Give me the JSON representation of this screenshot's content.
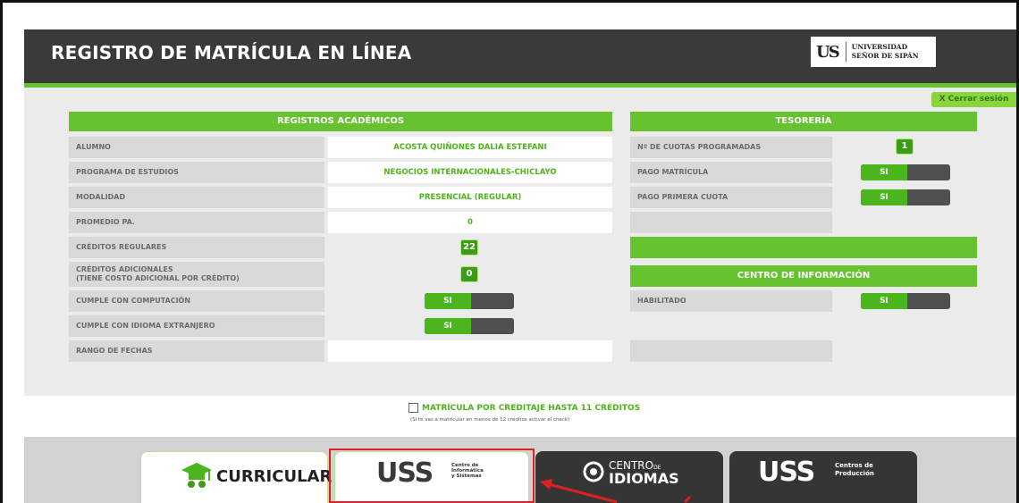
{
  "header": {
    "title": "REGISTRO DE MATRÍCULA EN LÍNEA",
    "logo_mark": "US",
    "logo_line1": "UNIVERSIDAD",
    "logo_line2": "SEÑOR DE SIPÁN",
    "logout": "X Cerrar sesión"
  },
  "academic": {
    "heading": "REGISTROS ACADÉMICOS",
    "rows": [
      {
        "label": "ALUMNO",
        "value": "ACOSTA QUIÑONES DALIA ESTEFANI"
      },
      {
        "label": "PROGRAMA DE ESTUDIOS",
        "value": "NEGOCIOS INTERNACIONALES-CHICLAYO"
      },
      {
        "label": "MODALIDAD",
        "value": "PRESENCIAL (REGULAR)"
      },
      {
        "label": "PROMEDIO PA.",
        "value": "0"
      },
      {
        "label": "CRÉDITOS REGULARES",
        "value": "22"
      },
      {
        "label": "CRÉDITOS ADICIONALES",
        "label2": "(TIENE COSTO ADICIONAL POR CRÉDITO)",
        "value": "0"
      },
      {
        "label": "CUMPLE CON COMPUTACIÓN",
        "value": "SI"
      },
      {
        "label": "CUMPLE CON IDIOMA EXTRANJERO",
        "value": "SI"
      },
      {
        "label": "RANGO DE FECHAS",
        "value": ""
      }
    ]
  },
  "treasury": {
    "heading": "TESORERÍA",
    "rows": [
      {
        "label": "Nº DE CUOTAS PROGRAMADAS",
        "value": "1"
      },
      {
        "label": "PAGO MATRÍCULA",
        "value": "SI"
      },
      {
        "label": "PAGO PRIMERA CUOTA",
        "value": "SI"
      }
    ]
  },
  "info_center": {
    "heading": "CENTRO DE INFORMACIÓN",
    "rows": [
      {
        "label": "HABILITADO",
        "value": "SI"
      }
    ]
  },
  "credit_option": {
    "label": "MATRÍCULA POR CREDITAJE HASTA 11 CRÉDITOS",
    "note": "(Si te vas a matricular en menos de 12 créditos activar el check)"
  },
  "tiles": {
    "curricular": "CURRICULAR",
    "informatica_logo": "USS",
    "informatica_l1": "Centro de",
    "informatica_l2": "Informática",
    "informatica_l3": "y Sistemas",
    "idiomas_l1": "CENTRO",
    "idiomas_de": "DE",
    "idiomas_l2": "IDIOMAS",
    "produccion_logo": "USS",
    "produccion_l1": "Centros de",
    "produccion_l2": "Producción"
  },
  "colors": {
    "accent_green": "#66c22e",
    "header_dark": "#3a3a3a",
    "highlight_red": "#e02020"
  }
}
